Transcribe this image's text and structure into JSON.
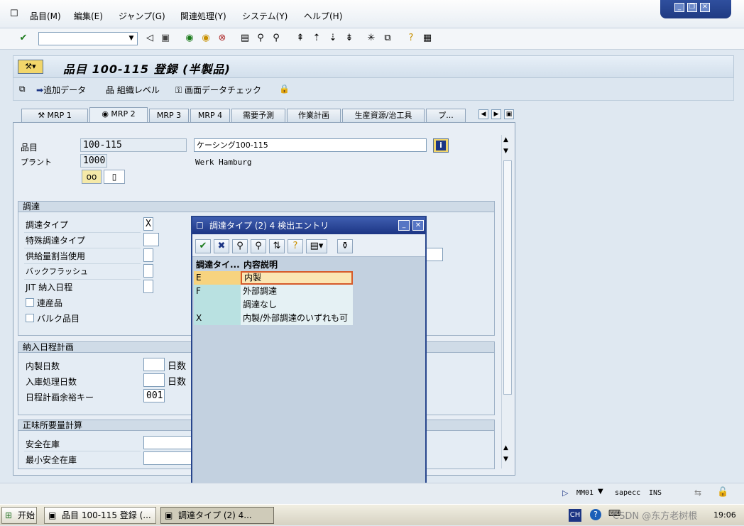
{
  "menubar": {
    "items": [
      "品目(M)",
      "編集(E)",
      "ジャンプ(G)",
      "関連処理(Y)",
      "システム(Y)",
      "ヘルプ(H)"
    ]
  },
  "title": "品目 100-115 登録 (半製品)",
  "app_toolbar": {
    "add_data": "追加データ",
    "org_level": "組織レベル",
    "screen_check": "画面データチェック"
  },
  "tabs": [
    "MRP 1",
    "MRP 2",
    "MRP 3",
    "MRP 4",
    "需要予測",
    "作業計画",
    "生産資源/治工具",
    "プ..."
  ],
  "active_tab": "MRP 2",
  "header": {
    "material_label": "品目",
    "material_value": "100-115",
    "material_desc": "ケーシング100-115",
    "plant_label": "プラント",
    "plant_value": "1000",
    "plant_desc": "Werk Hamburg"
  },
  "procurement": {
    "title": "調達",
    "proc_type_label": "調達タイプ",
    "proc_type_value": "X",
    "special_label": "特殊調達タイプ",
    "quota_label": "供給量割当使用",
    "backflush_label": "バックフラッシュ",
    "jit_label": "JIT 納入日程",
    "coproduct_label": "連産品",
    "bulk_label": "バルク品目"
  },
  "scheduling": {
    "title": "納入日程計画",
    "inhouse_label": "内製日数",
    "inhouse_unit": "日数",
    "gr_label": "入庫処理日数",
    "gr_unit": "日数",
    "margin_label": "日程計画余裕キー",
    "margin_value": "001"
  },
  "net_req": {
    "title": "正味所要量計算",
    "safety_label": "安全在庫",
    "min_safety_label": "最小安全在庫"
  },
  "popup": {
    "title": "調達タイプ (2)    4 検出エントリ",
    "col1": "調達タイ...",
    "col2": "内容説明",
    "rows": [
      {
        "code": "E",
        "desc": "内製"
      },
      {
        "code": "F",
        "desc": "外部調達"
      },
      {
        "code": "",
        "desc": "調達なし"
      },
      {
        "code": "X",
        "desc": "内製/外部調達のいずれも可"
      }
    ]
  },
  "status": {
    "tcode": "MM01",
    "server": "sapecc",
    "mode": "INS"
  },
  "taskbar": {
    "start": "开始",
    "task1": "品目 100-115 登録 (...",
    "task2": "調達タイプ (2)    4...",
    "lang": "CH",
    "time": "19:06",
    "watermark": "CSDN @东方老树根"
  },
  "colors": {
    "title_blue": "#1c3584",
    "selected_row": "#f7d37f",
    "code_cell": "#b9e1e1"
  }
}
